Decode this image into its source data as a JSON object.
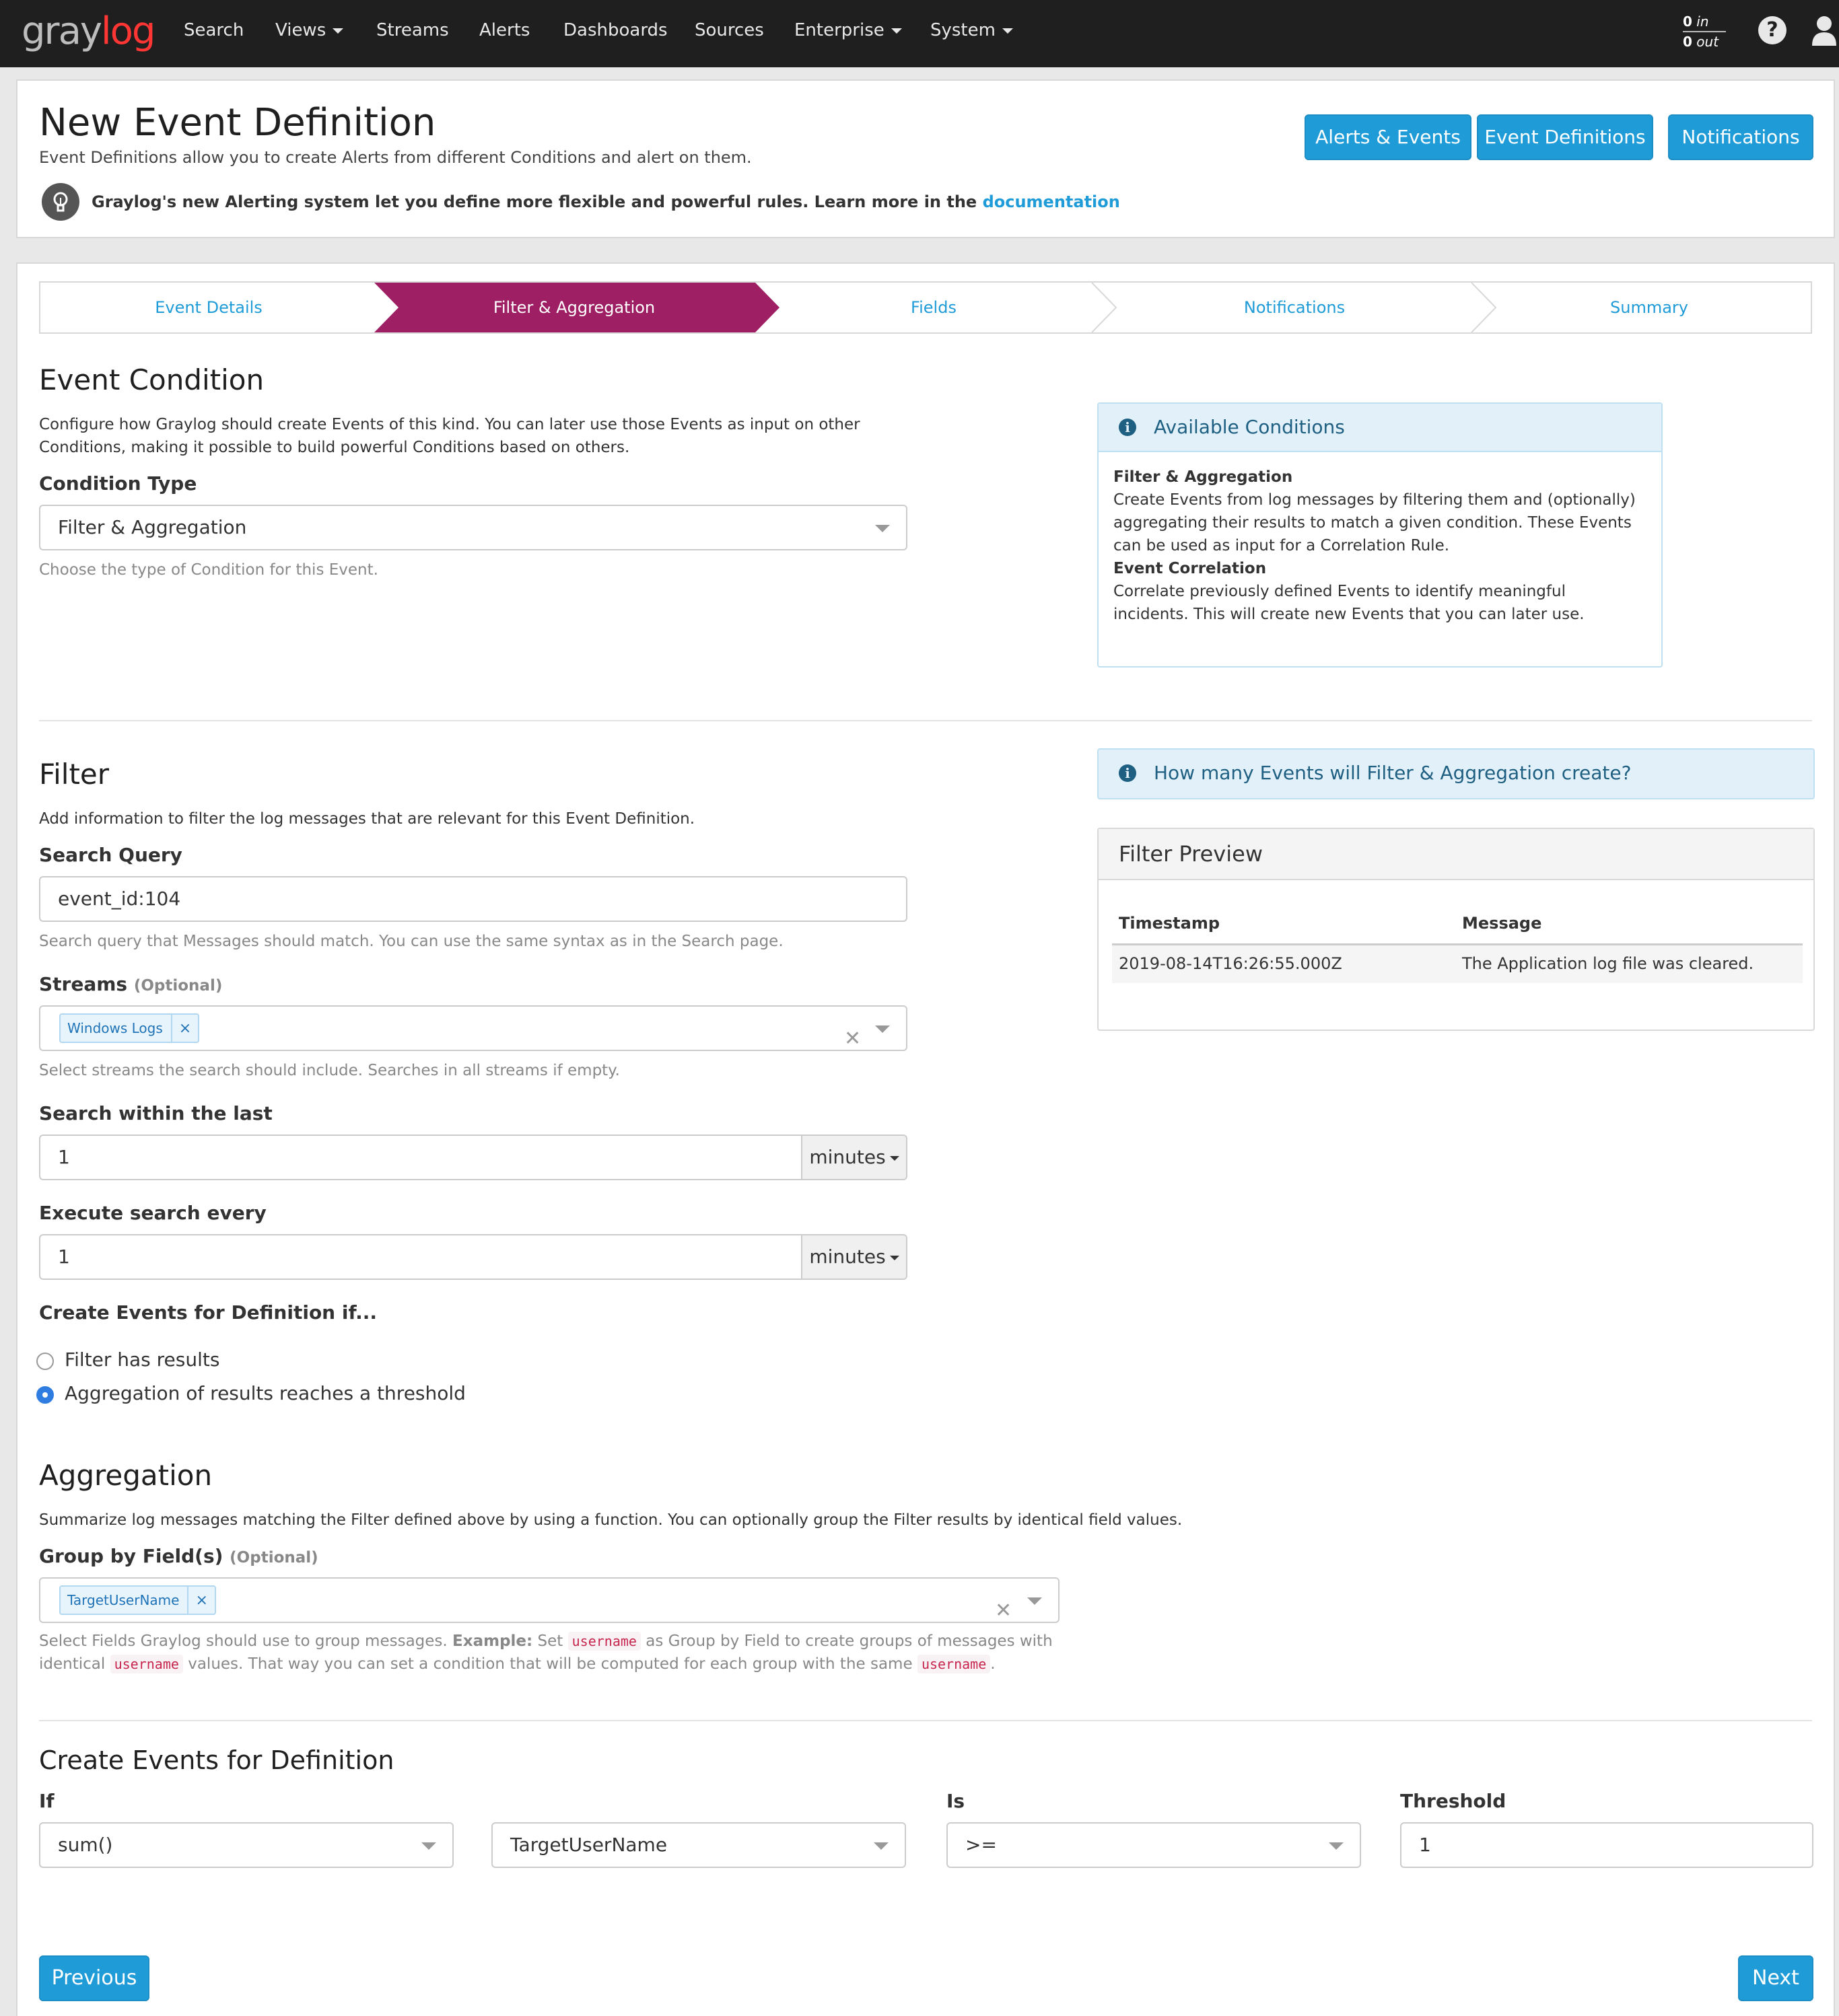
{
  "navbar": {
    "logo_gray": "gray",
    "logo_log": "log",
    "items": [
      "Search",
      "Views",
      "Streams",
      "Alerts",
      "Dashboards",
      "Sources",
      "Enterprise",
      "System"
    ],
    "throughput_in": "0",
    "throughput_in_label": "in",
    "throughput_out": "0",
    "throughput_out_label": "out",
    "help_icon": "question-circle-icon",
    "user_icon": "user-icon"
  },
  "header": {
    "title": "New Event Definition",
    "subtitle": "Event Definitions allow you to create Alerts from different Conditions and alert on them.",
    "buttons": [
      "Alerts & Events",
      "Event Definitions",
      "Notifications"
    ],
    "tip_text": "Graylog's new Alerting system let you define more flexible and powerful rules. Learn more in the",
    "tip_link": "documentation"
  },
  "wizard": {
    "steps": [
      "Event Details",
      "Filter & Aggregation",
      "Fields",
      "Notifications",
      "Summary"
    ],
    "active_step": 1,
    "active_color": "#9e1f63"
  },
  "event_condition": {
    "title": "Event Condition",
    "description": "Configure how Graylog should create Events of this kind. You can later use those Events as input on other Conditions, making it possible to build powerful Conditions based on others.",
    "condition_type_label": "Condition Type",
    "condition_type_value": "Filter & Aggregation",
    "condition_type_help": "Choose the type of Condition for this Event."
  },
  "available_conditions": {
    "title": "Available Conditions",
    "item1_title": "Filter & Aggregation",
    "item1_text": "Create Events from log messages by filtering them and (optionally) aggregating their results to match a given condition. These Events can be used as input for a Correlation Rule.",
    "item2_title": "Event Correlation",
    "item2_text": "Correlate previously defined Events to identify meaningful incidents. This will create new Events that you can later use."
  },
  "filter": {
    "title": "Filter",
    "description": "Add information to filter the log messages that are relevant for this Event Definition.",
    "search_query_label": "Search Query",
    "search_query_value": "event_id:104",
    "search_query_help": "Search query that Messages should match. You can use the same syntax as in the Search page.",
    "streams_label": "Streams",
    "streams_optional": "(Optional)",
    "streams_tag": "Windows Logs",
    "streams_help": "Select streams the search should include. Searches in all streams if empty.",
    "search_within_label": "Search within the last",
    "search_within_value": "1",
    "search_within_unit": "minutes",
    "execute_every_label": "Execute search every",
    "execute_every_value": "1",
    "execute_every_unit": "minutes",
    "create_events_label": "Create Events for Definition if...",
    "radio_option1": "Filter has results",
    "radio_option2": "Aggregation of results reaches a threshold",
    "selected_option": 2
  },
  "filter_info": {
    "title": "How many Events will Filter & Aggregation create?"
  },
  "filter_preview": {
    "title": "Filter Preview",
    "columns": [
      "Timestamp",
      "Message"
    ],
    "rows": [
      [
        "2019-08-14T16:26:55.000Z",
        "The Application log file was cleared."
      ]
    ]
  },
  "aggregation": {
    "title": "Aggregation",
    "description": "Summarize log messages matching the Filter defined above by using a function. You can optionally group the Filter results by identical field values.",
    "group_by_label": "Group by Field(s)",
    "group_by_optional": "(Optional)",
    "group_by_tag": "TargetUserName",
    "help_part1": "Select Fields Graylog should use to group messages.",
    "help_example": "Example:",
    "help_part2": "Set",
    "help_code": "username",
    "help_part3": "as Group by Field to create groups of messages with",
    "help_part4": "identical",
    "help_part5": "values. That way you can set a condition that will be computed for each group with the same",
    "help_part6": "."
  },
  "create_events": {
    "title": "Create Events for Definition",
    "if_label": "If",
    "function_value": "sum()",
    "field_value": "TargetUserName",
    "is_label": "Is",
    "operator_value": ">=",
    "threshold_label": "Threshold",
    "threshold_value": "1"
  },
  "footer": {
    "previous": "Previous",
    "next": "Next"
  }
}
